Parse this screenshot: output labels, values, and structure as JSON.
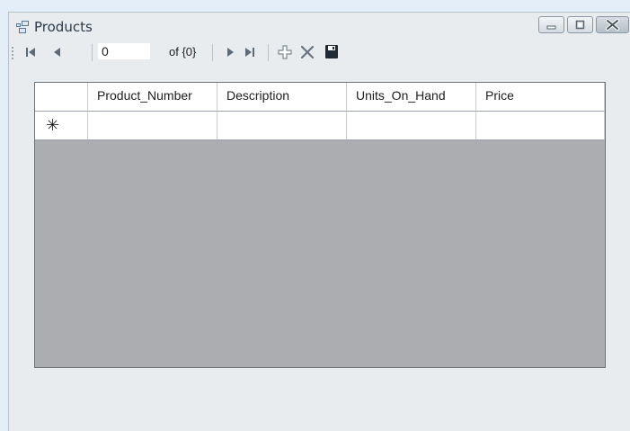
{
  "window": {
    "title": "Products",
    "icon": "form-icon",
    "buttons": [
      "minimize-icon",
      "maximize-icon",
      "close-icon"
    ]
  },
  "navigator": {
    "position_value": "0",
    "count_label": "of {0}",
    "icons": [
      "move-first-icon",
      "move-previous-icon",
      "move-next-icon",
      "move-last-icon",
      "add-new-icon",
      "delete-icon",
      "save-icon"
    ]
  },
  "grid": {
    "columns": [
      "Product_Number",
      "Description",
      "Units_On_Hand",
      "Price"
    ],
    "new_row_marker": "✳",
    "background": "#abadb0"
  }
}
